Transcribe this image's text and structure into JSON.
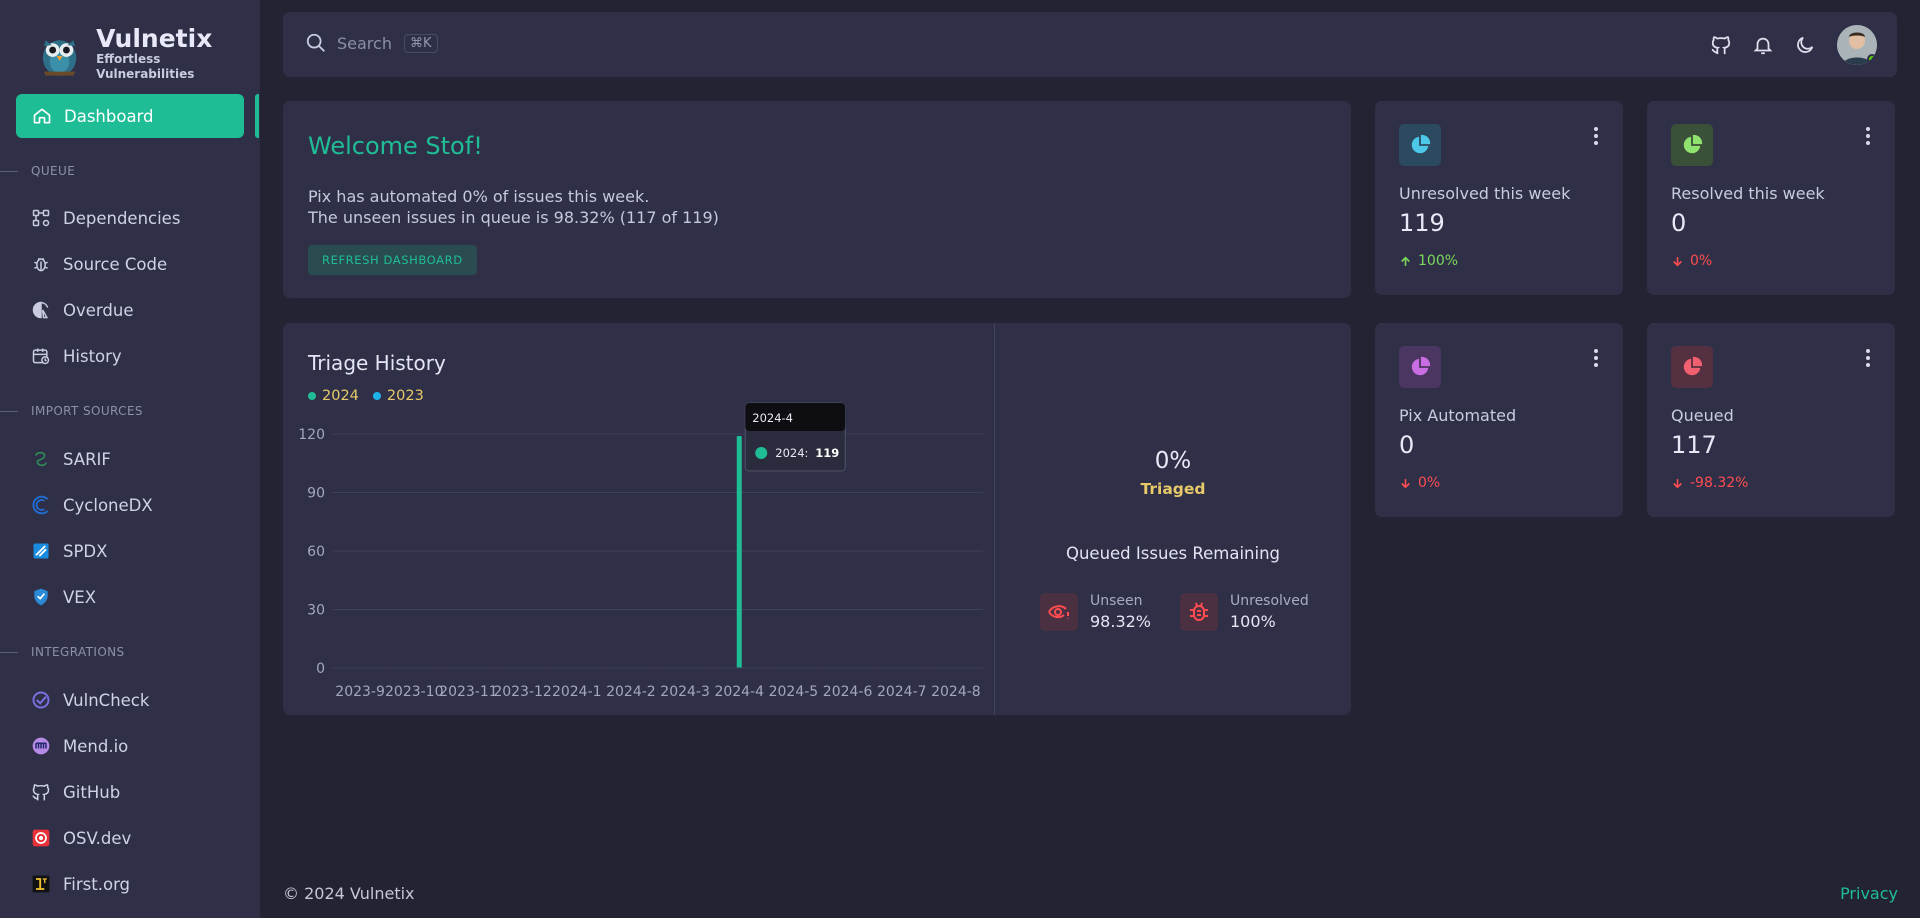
{
  "brand": {
    "name": "Vulnetix",
    "tagline": "Effortless Vulnerabilities"
  },
  "sidebar": {
    "active": {
      "label": "Dashboard",
      "icon": "home-icon"
    },
    "sections": [
      {
        "title": "QUEUE",
        "items": [
          {
            "label": "Dependencies",
            "icon": "dependencies-icon"
          },
          {
            "label": "Source Code",
            "icon": "bug-icon"
          },
          {
            "label": "Overdue",
            "icon": "hourglass-icon"
          },
          {
            "label": "History",
            "icon": "calendar-history-icon"
          }
        ]
      },
      {
        "title": "IMPORT SOURCES",
        "items": [
          {
            "label": "SARIF",
            "icon": "sarif-icon"
          },
          {
            "label": "CycloneDX",
            "icon": "cyclonedx-icon"
          },
          {
            "label": "SPDX",
            "icon": "spdx-icon"
          },
          {
            "label": "VEX",
            "icon": "vex-shield-icon"
          }
        ]
      },
      {
        "title": "INTEGRATIONS",
        "items": [
          {
            "label": "VulnCheck",
            "icon": "vulncheck-icon"
          },
          {
            "label": "Mend.io",
            "icon": "mend-icon"
          },
          {
            "label": "GitHub",
            "icon": "github-icon"
          },
          {
            "label": "OSV.dev",
            "icon": "osv-icon"
          },
          {
            "label": "First.org",
            "icon": "first-org-icon"
          }
        ]
      }
    ]
  },
  "topbar": {
    "search_placeholder": "Search",
    "shortcut": "⌘K"
  },
  "welcome": {
    "title": "Welcome Stof!",
    "line1": "Pix has automated 0% of issues this week.",
    "line2": "The unseen issues in queue is 98.32% (117 of 119)",
    "button": "REFRESH DASHBOARD"
  },
  "stats": [
    {
      "label": "Unresolved this week",
      "value": "119",
      "change": "100%",
      "trend": "up",
      "color": "#4dc8e8"
    },
    {
      "label": "Resolved this week",
      "value": "0",
      "change": "0%",
      "trend": "down",
      "color": "#8ee26d"
    },
    {
      "label": "Pix Automated",
      "value": "0",
      "change": "0%",
      "trend": "down",
      "color": "#c86ee2"
    },
    {
      "label": "Queued",
      "value": "117",
      "change": "-98.32%",
      "trend": "down",
      "color": "#f06070"
    }
  ],
  "triage": {
    "title": "Triage History",
    "percent": "0%",
    "percent_label": "Triaged",
    "queued_title": "Queued Issues Remaining",
    "unseen": {
      "label": "Unseen",
      "value": "98.32%"
    },
    "unresolved": {
      "label": "Unresolved",
      "value": "100%"
    }
  },
  "chart_data": {
    "type": "bar",
    "title": "Triage History",
    "categories": [
      "2023-9",
      "2023-10",
      "2023-11",
      "2023-12",
      "2024-1",
      "2024-2",
      "2024-3",
      "2024-4",
      "2024-5",
      "2024-6",
      "2024-7",
      "2024-8"
    ],
    "series": [
      {
        "name": "2024",
        "color": "#1fbd96",
        "values": [
          0,
          0,
          0,
          0,
          0,
          0,
          0,
          119,
          0,
          0,
          0,
          0
        ]
      },
      {
        "name": "2023",
        "color": "#1db2e8",
        "values": [
          0,
          0,
          0,
          0,
          0,
          0,
          0,
          0,
          0,
          0,
          0,
          0
        ]
      }
    ],
    "yticks": [
      0,
      30,
      60,
      90,
      120
    ],
    "ylim": [
      0,
      120
    ],
    "tooltip": {
      "title": "2024-4",
      "series": "2024:",
      "value": "119"
    }
  },
  "footer": {
    "copyright": "© 2024 Vulnetix",
    "privacy": "Privacy"
  }
}
